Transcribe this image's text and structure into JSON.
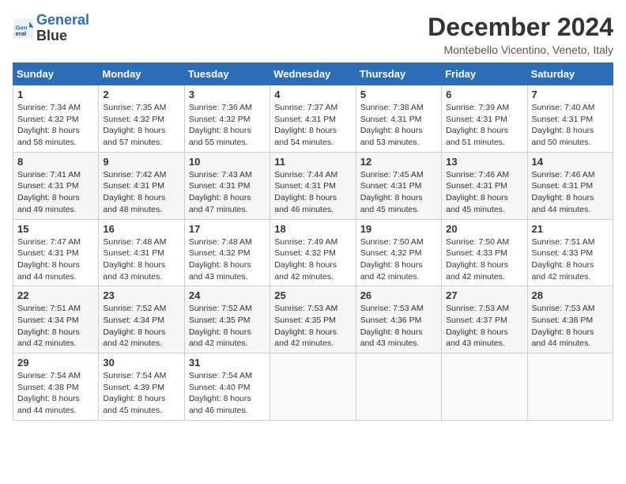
{
  "header": {
    "logo_line1": "General",
    "logo_line2": "Blue",
    "month_title": "December 2024",
    "location": "Montebello Vicentino, Veneto, Italy"
  },
  "weekdays": [
    "Sunday",
    "Monday",
    "Tuesday",
    "Wednesday",
    "Thursday",
    "Friday",
    "Saturday"
  ],
  "weeks": [
    [
      {
        "day": "1",
        "sunrise": "7:34 AM",
        "sunset": "4:32 PM",
        "daylight": "8 hours and 58 minutes."
      },
      {
        "day": "2",
        "sunrise": "7:35 AM",
        "sunset": "4:32 PM",
        "daylight": "8 hours and 57 minutes."
      },
      {
        "day": "3",
        "sunrise": "7:36 AM",
        "sunset": "4:32 PM",
        "daylight": "8 hours and 55 minutes."
      },
      {
        "day": "4",
        "sunrise": "7:37 AM",
        "sunset": "4:31 PM",
        "daylight": "8 hours and 54 minutes."
      },
      {
        "day": "5",
        "sunrise": "7:38 AM",
        "sunset": "4:31 PM",
        "daylight": "8 hours and 53 minutes."
      },
      {
        "day": "6",
        "sunrise": "7:39 AM",
        "sunset": "4:31 PM",
        "daylight": "8 hours and 51 minutes."
      },
      {
        "day": "7",
        "sunrise": "7:40 AM",
        "sunset": "4:31 PM",
        "daylight": "8 hours and 50 minutes."
      }
    ],
    [
      {
        "day": "8",
        "sunrise": "7:41 AM",
        "sunset": "4:31 PM",
        "daylight": "8 hours and 49 minutes."
      },
      {
        "day": "9",
        "sunrise": "7:42 AM",
        "sunset": "4:31 PM",
        "daylight": "8 hours and 48 minutes."
      },
      {
        "day": "10",
        "sunrise": "7:43 AM",
        "sunset": "4:31 PM",
        "daylight": "8 hours and 47 minutes."
      },
      {
        "day": "11",
        "sunrise": "7:44 AM",
        "sunset": "4:31 PM",
        "daylight": "8 hours and 46 minutes."
      },
      {
        "day": "12",
        "sunrise": "7:45 AM",
        "sunset": "4:31 PM",
        "daylight": "8 hours and 45 minutes."
      },
      {
        "day": "13",
        "sunrise": "7:46 AM",
        "sunset": "4:31 PM",
        "daylight": "8 hours and 45 minutes."
      },
      {
        "day": "14",
        "sunrise": "7:46 AM",
        "sunset": "4:31 PM",
        "daylight": "8 hours and 44 minutes."
      }
    ],
    [
      {
        "day": "15",
        "sunrise": "7:47 AM",
        "sunset": "4:31 PM",
        "daylight": "8 hours and 44 minutes."
      },
      {
        "day": "16",
        "sunrise": "7:48 AM",
        "sunset": "4:31 PM",
        "daylight": "8 hours and 43 minutes."
      },
      {
        "day": "17",
        "sunrise": "7:48 AM",
        "sunset": "4:32 PM",
        "daylight": "8 hours and 43 minutes."
      },
      {
        "day": "18",
        "sunrise": "7:49 AM",
        "sunset": "4:32 PM",
        "daylight": "8 hours and 42 minutes."
      },
      {
        "day": "19",
        "sunrise": "7:50 AM",
        "sunset": "4:32 PM",
        "daylight": "8 hours and 42 minutes."
      },
      {
        "day": "20",
        "sunrise": "7:50 AM",
        "sunset": "4:33 PM",
        "daylight": "8 hours and 42 minutes."
      },
      {
        "day": "21",
        "sunrise": "7:51 AM",
        "sunset": "4:33 PM",
        "daylight": "8 hours and 42 minutes."
      }
    ],
    [
      {
        "day": "22",
        "sunrise": "7:51 AM",
        "sunset": "4:34 PM",
        "daylight": "8 hours and 42 minutes."
      },
      {
        "day": "23",
        "sunrise": "7:52 AM",
        "sunset": "4:34 PM",
        "daylight": "8 hours and 42 minutes."
      },
      {
        "day": "24",
        "sunrise": "7:52 AM",
        "sunset": "4:35 PM",
        "daylight": "8 hours and 42 minutes."
      },
      {
        "day": "25",
        "sunrise": "7:53 AM",
        "sunset": "4:35 PM",
        "daylight": "8 hours and 42 minutes."
      },
      {
        "day": "26",
        "sunrise": "7:53 AM",
        "sunset": "4:36 PM",
        "daylight": "8 hours and 43 minutes."
      },
      {
        "day": "27",
        "sunrise": "7:53 AM",
        "sunset": "4:37 PM",
        "daylight": "8 hours and 43 minutes."
      },
      {
        "day": "28",
        "sunrise": "7:53 AM",
        "sunset": "4:38 PM",
        "daylight": "8 hours and 44 minutes."
      }
    ],
    [
      {
        "day": "29",
        "sunrise": "7:54 AM",
        "sunset": "4:38 PM",
        "daylight": "8 hours and 44 minutes."
      },
      {
        "day": "30",
        "sunrise": "7:54 AM",
        "sunset": "4:39 PM",
        "daylight": "8 hours and 45 minutes."
      },
      {
        "day": "31",
        "sunrise": "7:54 AM",
        "sunset": "4:40 PM",
        "daylight": "8 hours and 46 minutes."
      },
      null,
      null,
      null,
      null
    ]
  ]
}
